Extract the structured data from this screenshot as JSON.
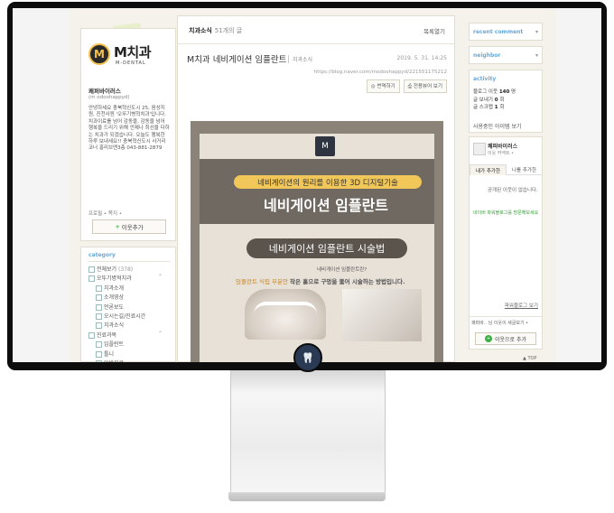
{
  "profile": {
    "logo_mark": "M",
    "logo_text": "M치과",
    "logo_sub": "M-DENTAL",
    "nick": "쾌퍼바이러스",
    "id": "(m odoohappyd)",
    "desc": "안녕하세요 충북혁신도시 25, 음성지원, 진천사원 '오뚜기병혁치과'입니다. 치과이료를 넘어 감동을, 감동을 넘어 행복을 드리기 위해 언제나 최선을 다하는 치과가 되겠습니다. 오늘도 행복한 하루 보내세요!! 충북혁신도시 사거리코너 홍리브엔3층 043-881-2879",
    "links": "프로필 • 쪽지 •",
    "add_label": "이웃추가"
  },
  "category": {
    "title": "category",
    "items": [
      {
        "label": "전체보기",
        "count": "(378)",
        "sub": false,
        "toggle": ""
      },
      {
        "label": "오뚜기병혁치과",
        "count": "",
        "sub": false,
        "toggle": "⌃"
      },
      {
        "label": "치과소개",
        "count": "",
        "sub": true,
        "toggle": ""
      },
      {
        "label": "소개영상",
        "count": "",
        "sub": true,
        "toggle": ""
      },
      {
        "label": "언론보도",
        "count": "",
        "sub": true,
        "toggle": ""
      },
      {
        "label": "오시는길/진료시간",
        "count": "",
        "sub": true,
        "toggle": ""
      },
      {
        "label": "치과소식",
        "count": "",
        "sub": true,
        "toggle": ""
      },
      {
        "label": "진료과목",
        "count": "",
        "sub": false,
        "toggle": "⌃"
      },
      {
        "label": "임플란트",
        "count": "",
        "sub": true,
        "toggle": ""
      },
      {
        "label": "틀니",
        "count": "",
        "sub": true,
        "toggle": ""
      },
      {
        "label": "일반진료",
        "count": "",
        "sub": true,
        "toggle": ""
      }
    ]
  },
  "main": {
    "section": "치과소식",
    "count": "51개의 글",
    "list_toggle": "목록열기",
    "title": "M치과 네비게이션 임플란트",
    "category": "치과소식",
    "date": "2019. 5. 31. 14:25",
    "url": "https://blog.naver.com/modoohappyd/221551175212",
    "btn_translate": "번역하기",
    "btn_print": "전용뷰어 보기"
  },
  "poster": {
    "mark": "M",
    "tagline": "네비게이션의 원리를 이용한 3D 디지털기술",
    "headline": "네비게이션 임플란트",
    "subtitle": "네비게이션 임플란트 시술법",
    "small_q": "네비게이션 임플란트란?",
    "desc_a": "임플란트 식립 부분만",
    "desc_b": "작은 홀으로 구멍을 뚫어 시술하는 방법",
    "desc_c": "입니다."
  },
  "widgets": {
    "recent": "recent comment",
    "neighbor": "neighbor",
    "activity": {
      "title": "activity",
      "rows": [
        {
          "k": "블로그 이웃",
          "v": "140",
          "u": "명"
        },
        {
          "k": "글 보내기",
          "v": "0",
          "u": "회"
        },
        {
          "k": "글 스크랩",
          "v": "1",
          "u": "회"
        }
      ],
      "visitors": "사용중인 아이템 보기"
    },
    "buddy": {
      "name": "쾌퍼바이러스",
      "sub": "이웃 커넥트 •",
      "tab_mine": "내가 추가한",
      "tab_other": "나를 추가한",
      "empty": "공개된 이웃이 없습니다.",
      "green": "네이버 파워블로그를 방문해보세요",
      "more": "파워블로그 보기",
      "comment": "쾌퍼바..  님 이웃이 새글보기 •",
      "add": "이웃으로 추가"
    },
    "top": "TOP"
  },
  "device": {
    "stand_logo": "🦷"
  }
}
